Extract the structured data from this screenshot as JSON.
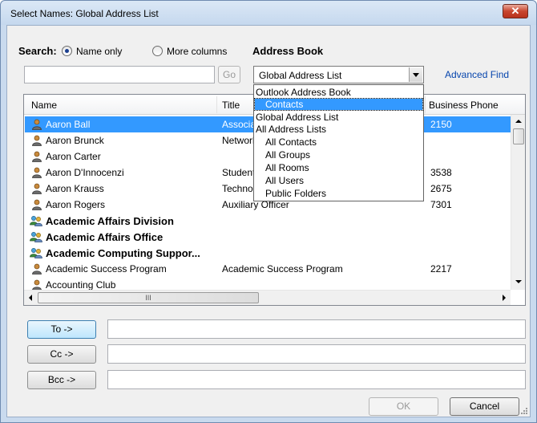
{
  "window": {
    "title": "Select Names: Global Address List",
    "close_label": "✕"
  },
  "search": {
    "label": "Search:",
    "option_name_only": "Name only",
    "option_more_columns": "More columns",
    "selected": "Name only",
    "input_value": "",
    "go_label": "Go"
  },
  "address_book": {
    "label": "Address Book",
    "selected": "Global Address List",
    "advanced_find": "Advanced Find",
    "options": [
      "Outlook Address Book",
      "Contacts",
      "Global Address List",
      "All Address Lists",
      "All Contacts",
      "All Groups",
      "All Rooms",
      "All Users",
      "Public Folders"
    ],
    "highlighted": "Contacts"
  },
  "table": {
    "columns": [
      "Name",
      "Title",
      "Business Phone"
    ],
    "rows": [
      {
        "name": "Aaron Ball",
        "title": "Associa",
        "phone": "2150",
        "type": "person",
        "bold": false,
        "selected": true
      },
      {
        "name": "Aaron Brunck",
        "title": "Network",
        "phone": "",
        "type": "person",
        "bold": false,
        "selected": false
      },
      {
        "name": "Aaron Carter",
        "title": "",
        "phone": "",
        "type": "person",
        "bold": false,
        "selected": false
      },
      {
        "name": "Aaron D'Innocenzi",
        "title": "Student",
        "phone": "3538",
        "type": "person",
        "bold": false,
        "selected": false
      },
      {
        "name": "Aaron Krauss",
        "title": "Technol",
        "phone": "2675",
        "type": "person",
        "bold": false,
        "selected": false
      },
      {
        "name": "Aaron Rogers",
        "title": "Auxiliary Officer",
        "phone": "7301",
        "type": "person",
        "bold": false,
        "selected": false
      },
      {
        "name": "Academic Affairs Division",
        "title": "",
        "phone": "",
        "type": "group",
        "bold": true,
        "selected": false
      },
      {
        "name": "Academic Affairs Office",
        "title": "",
        "phone": "",
        "type": "group",
        "bold": true,
        "selected": false
      },
      {
        "name": "Academic Computing Suppor...",
        "title": "",
        "phone": "",
        "type": "group",
        "bold": true,
        "selected": false
      },
      {
        "name": "Academic Success Program",
        "title": "Academic Success Program",
        "phone": "2217",
        "type": "person",
        "bold": false,
        "selected": false
      },
      {
        "name": "Accounting Club",
        "title": "",
        "phone": "",
        "type": "person",
        "bold": false,
        "selected": false
      }
    ],
    "hscroll_grip": "III"
  },
  "recipients": {
    "to_label": "To ->",
    "cc_label": "Cc ->",
    "bcc_label": "Bcc ->",
    "to_value": "",
    "cc_value": "",
    "bcc_value": ""
  },
  "footer": {
    "ok_label": "OK",
    "cancel_label": "Cancel"
  },
  "colors": {
    "selection": "#3399ff",
    "link": "#0645ad",
    "frame": "#c9daee"
  }
}
